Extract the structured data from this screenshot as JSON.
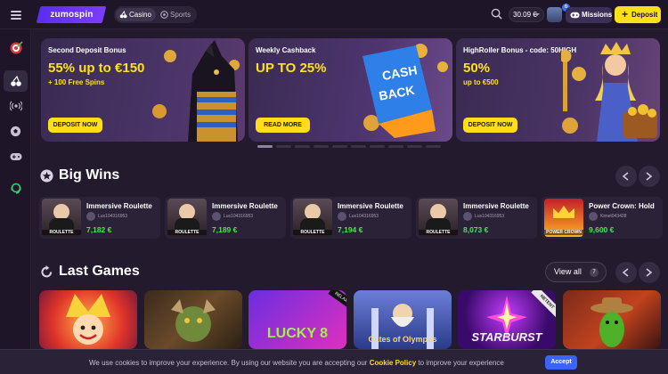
{
  "header": {
    "logo": "zumospin",
    "tabs": [
      {
        "label": "Casino",
        "icon": "cherries-icon"
      },
      {
        "label": "Sports",
        "icon": "soccer-ball-icon"
      }
    ],
    "balance": "30.09 €",
    "notification_count": "6",
    "missions_label": "Missions",
    "deposit_label": "Deposit"
  },
  "sidebar": {
    "items": [
      "home-icon",
      "cherries-icon",
      "live-icon",
      "soccer-ball-icon",
      "gamepad-icon",
      "support-icon"
    ]
  },
  "banners": [
    {
      "subtitle": "Second Deposit Bonus",
      "title": "55% up to €150",
      "extra": "+ 100 Free Spins",
      "button": "DEPOSIT NOW"
    },
    {
      "subtitle": "Weekly Cashback",
      "title": "UP TO 25%",
      "extra": "",
      "button": "READ MORE",
      "art_text": "CASH BACK"
    },
    {
      "subtitle": "HighRoller Bonus - code: 50HIGH",
      "title": "50%",
      "extra": "up to €500",
      "button": "DEPOSIT NOW"
    }
  ],
  "carousel": {
    "count": 10,
    "active": 0
  },
  "big_wins": {
    "title": "Big Wins",
    "items": [
      {
        "game": "Immersive Roulette",
        "user": "Lus10431695​3",
        "amount": "7,182 €",
        "thumb": "ROULETTE"
      },
      {
        "game": "Immersive Roulette",
        "user": "Lus104316953",
        "amount": "7,189 €",
        "thumb": "ROULETTE"
      },
      {
        "game": "Immersive Roulette",
        "user": "Lus104316953",
        "amount": "7,194 €",
        "thumb": "ROULETTE"
      },
      {
        "game": "Immersive Roulette",
        "user": "Lus104316953",
        "amount": "8,073 €",
        "thumb": "ROULETTE"
      },
      {
        "game": "Power Crown: Hold",
        "user": "Kimet043428",
        "amount": "9,600 €",
        "thumb": "POWER CROWN"
      }
    ]
  },
  "last_games": {
    "title": "Last Games",
    "view_all": "View all",
    "view_all_count": "7",
    "items": [
      {
        "label": "",
        "badge": ""
      },
      {
        "label": "",
        "badge": ""
      },
      {
        "label": "LUCKY 8",
        "badge": "RELAX"
      },
      {
        "label": "Gates of Olympus",
        "badge": ""
      },
      {
        "label": "STARBURST",
        "badge": "NETENT"
      },
      {
        "label": "",
        "badge": ""
      }
    ]
  },
  "cookie": {
    "text_before": "We use cookies to improve your experience. By using our website you are accepting our ",
    "link": "Cookie Policy",
    "text_after": " to improve your experience",
    "accept": "Accept"
  },
  "colors": {
    "accent": "#ffde1a",
    "win_green": "#4ee05a",
    "brand_purple": "#5a2df0",
    "bg": "#231a2d"
  }
}
